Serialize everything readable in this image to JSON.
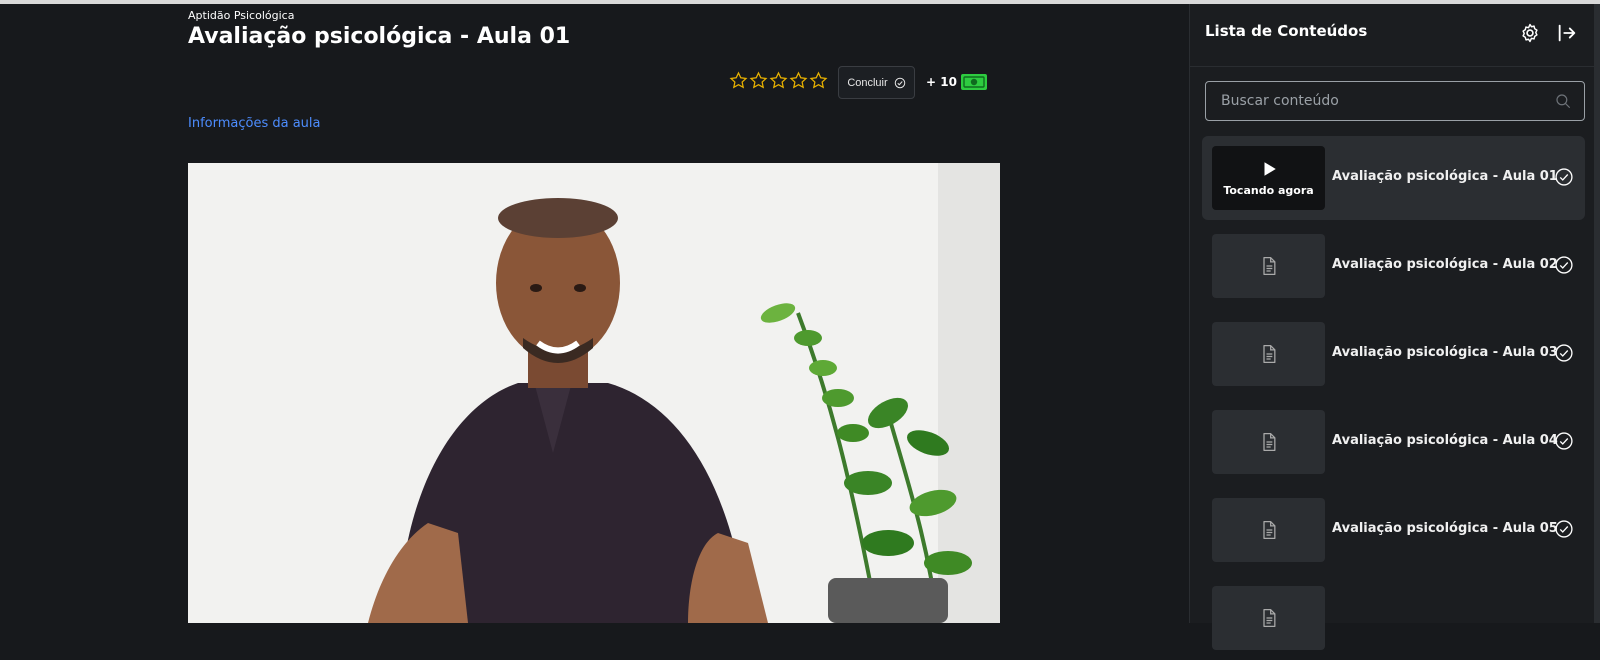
{
  "header": {
    "course": "Aptidão Psicológica",
    "title": "Avaliação psicológica - Aula 01"
  },
  "rating": {
    "stars_total": 5,
    "stars_filled": 0,
    "star_color": "#e8b100"
  },
  "actions": {
    "complete_label": "Concluir",
    "points_label": "+ 10"
  },
  "info_link": "Informações da aula",
  "sidebar": {
    "title": "Lista de Conteúdos",
    "search_placeholder": "Buscar conteúdo",
    "now_playing_label": "Tocando agora",
    "items": [
      {
        "label": "Avaliação psicológica - Aula 01",
        "active": true
      },
      {
        "label": "Avaliação psicológica - Aula 02",
        "active": false
      },
      {
        "label": "Avaliação psicológica - Aula 03",
        "active": false
      },
      {
        "label": "Avaliação psicológica - Aula 04",
        "active": false
      },
      {
        "label": "Avaliação psicológica - Aula 05",
        "active": false
      }
    ]
  },
  "colors": {
    "background": "#17191c",
    "sidebar": "#1b1d20",
    "link": "#4d8dff",
    "money_green": "#2ecc40"
  }
}
